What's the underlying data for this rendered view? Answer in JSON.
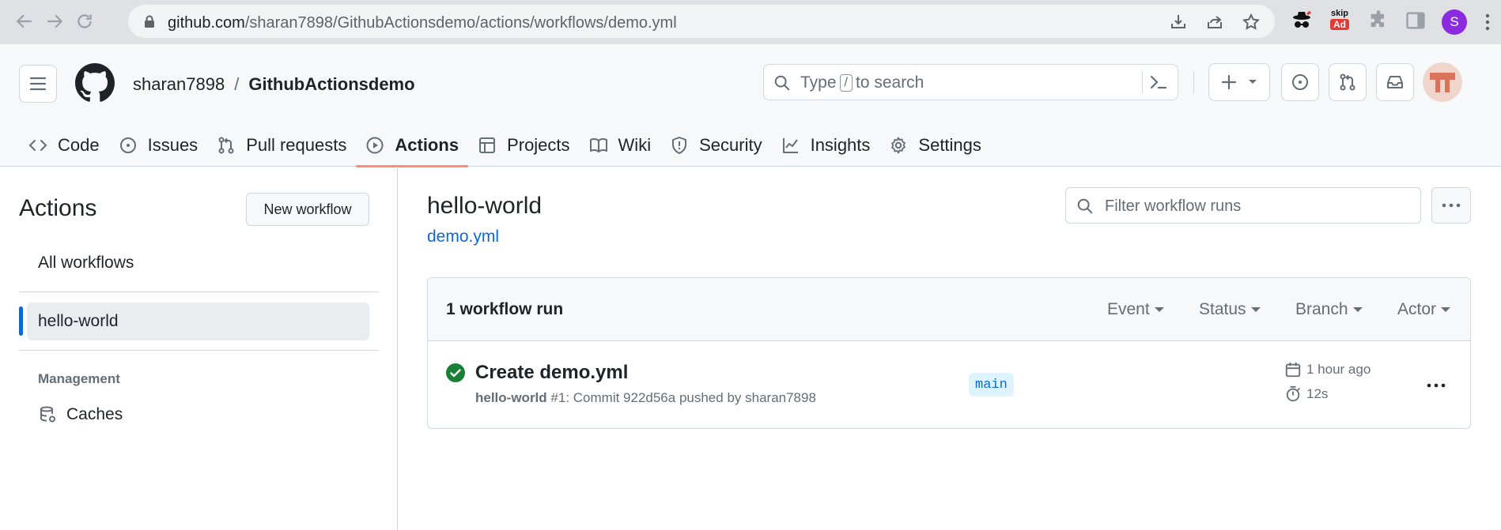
{
  "browser": {
    "url_host": "github.com",
    "url_path": "/sharan7898/GithubActionsdemo/actions/workflows/demo.yml",
    "profile_initial": "S",
    "extensions": [
      "spy-extension-icon",
      "skip-ad-extension-icon",
      "puzzle-extensions-icon",
      "sidebar-icon"
    ],
    "ext_skip_label_top": "skip",
    "ext_skip_label_bottom": "Ad"
  },
  "header": {
    "owner": "sharan7898",
    "separator": "/",
    "repo": "GithubActionsdemo",
    "search_before": "Type",
    "search_key": "/",
    "search_after": "to search"
  },
  "tabs": [
    {
      "label": "Code",
      "icon": "code-icon"
    },
    {
      "label": "Issues",
      "icon": "issue-icon"
    },
    {
      "label": "Pull requests",
      "icon": "pull-request-icon"
    },
    {
      "label": "Actions",
      "icon": "play-icon",
      "selected": true
    },
    {
      "label": "Projects",
      "icon": "table-icon"
    },
    {
      "label": "Wiki",
      "icon": "book-icon"
    },
    {
      "label": "Security",
      "icon": "shield-icon"
    },
    {
      "label": "Insights",
      "icon": "graph-icon"
    },
    {
      "label": "Settings",
      "icon": "gear-icon"
    }
  ],
  "sidebar": {
    "title": "Actions",
    "new_workflow": "New workflow",
    "all_workflows": "All workflows",
    "active_workflow": "hello-world",
    "section_label": "Management",
    "caches": "Caches"
  },
  "main": {
    "workflow_name": "hello-world",
    "workflow_file": "demo.yml",
    "filter_placeholder": "Filter workflow runs",
    "runs_count": "1 workflow run",
    "filters": [
      "Event",
      "Status",
      "Branch",
      "Actor"
    ],
    "runs": [
      {
        "status": "success",
        "title": "Create demo.yml",
        "workflow": "hello-world",
        "meta": "#1: Commit 922d56a pushed by sharan7898",
        "branch": "main",
        "time_ago": "1 hour ago",
        "duration": "12s"
      }
    ]
  },
  "colors": {
    "accent_blue": "#0969da",
    "success_green": "#1a7f37",
    "tab_underline": "#fd8c73"
  }
}
